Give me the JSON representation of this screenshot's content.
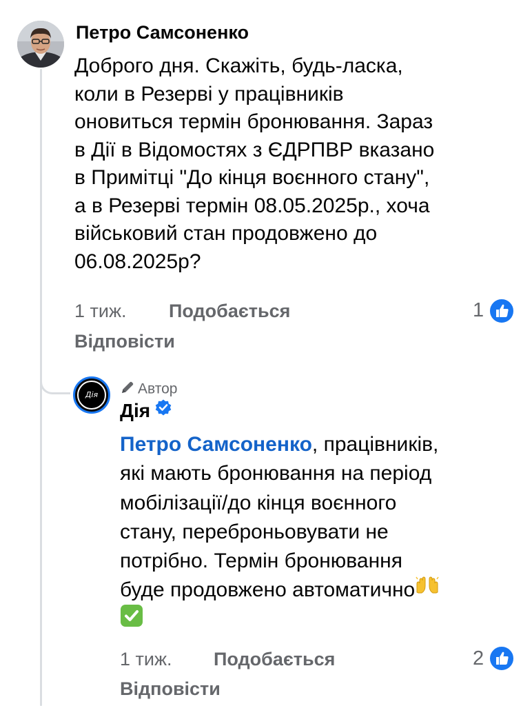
{
  "comment": {
    "author": "Петро Самсоненко",
    "lines": [
      "Доброго дня. Скажіть, будь-ласка,",
      "коли в Резерві у працівників",
      "оновиться термін бронювання. Зараз",
      "в Дії в Відомостях з ЄДРПВР вказано",
      "в Примітці \"До кінця воєнного стану\",",
      "а в Резерві термін 08.05.2025р., хоча",
      "військовий стан продовжено до",
      "06.08.2025р?"
    ],
    "time": "1 тиж.",
    "like_label": "Подобається",
    "reply_label": "Відповісти",
    "reaction_count": "1",
    "reaction_icon": "like-thumbs-up-icon"
  },
  "reply": {
    "author_badge": "Автор",
    "author_badge_icon": "pencil-icon",
    "page_name": "Дія",
    "verified_icon": "verified-badge-icon",
    "avatar_text": "Дія",
    "mention": "Петро Самсоненко",
    "lines": [
      ", працівників,",
      "які мають бронювання на період",
      "мобілізації/до кінця воєнного",
      "стану, переброньовувати не",
      "потрібно. Термін бронювання",
      "буде продовжено автоматично"
    ],
    "emoji_hands": "raising-hands-emoji",
    "emoji_check": "check-mark-emoji",
    "time": "1 тиж.",
    "like_label": "Подобається",
    "reply_label": "Відповісти",
    "reaction_count": "2",
    "reaction_icon": "like-thumbs-up-icon"
  },
  "colors": {
    "accent_blue": "#1877f2",
    "mention_blue": "#1463c9",
    "meta_gray": "#65676b",
    "thread_line": "#dadde1"
  }
}
